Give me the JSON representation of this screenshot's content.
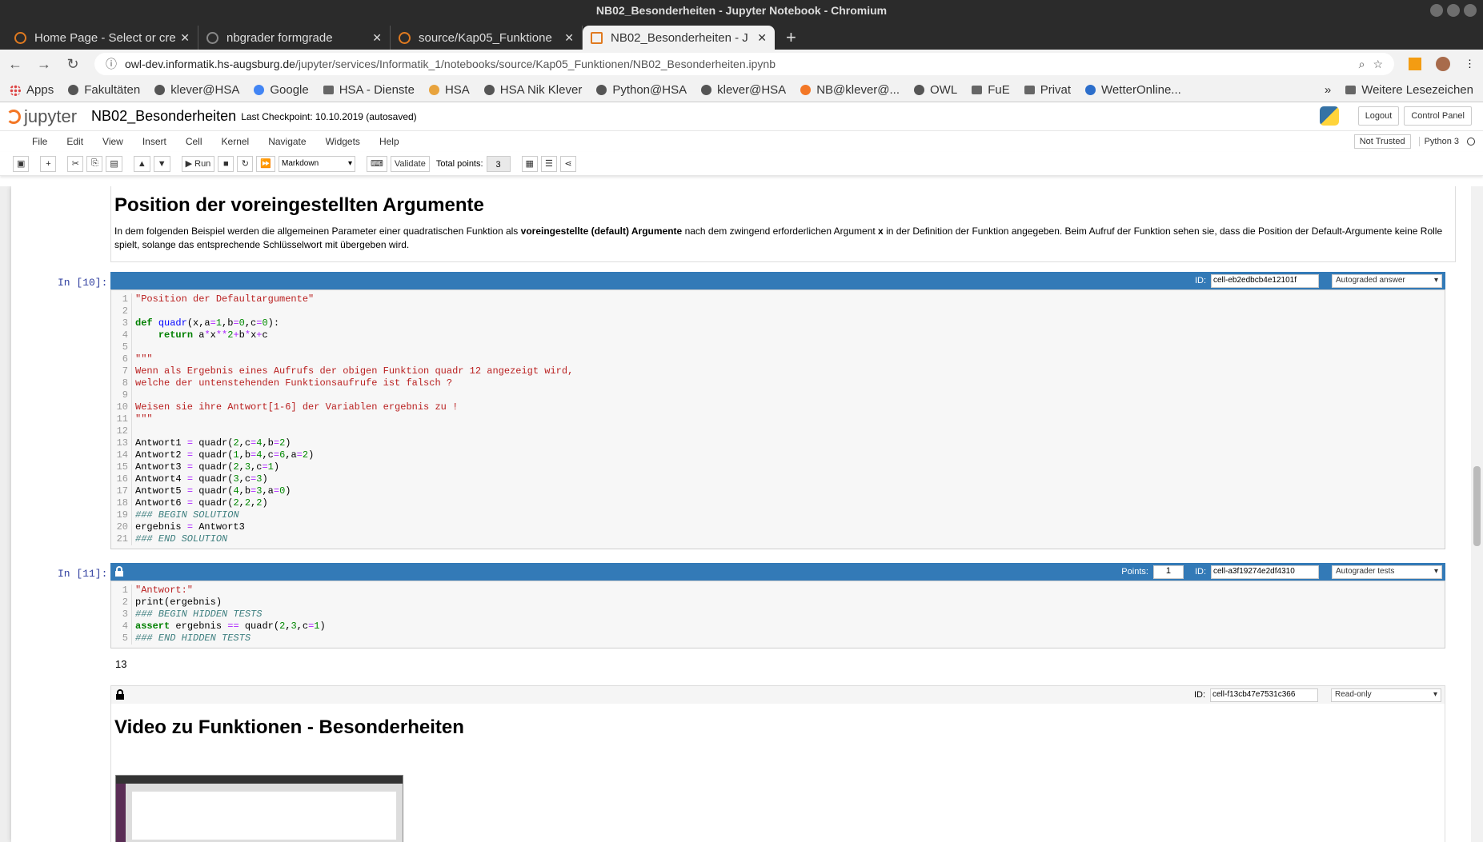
{
  "window": {
    "title": "NB02_Besonderheiten - Jupyter Notebook - Chromium"
  },
  "tabs": [
    {
      "label": "Home Page - Select or cre",
      "active": false
    },
    {
      "label": "nbgrader formgrade",
      "active": false
    },
    {
      "label": "source/Kap05_Funktione",
      "active": false
    },
    {
      "label": "NB02_Besonderheiten - J",
      "active": true
    }
  ],
  "address": {
    "host": "owl-dev.informatik.hs-augsburg.de",
    "path": "/jupyter/services/Informatik_1/notebooks/source/Kap05_Funktionen/NB02_Besonderheiten.ipynb"
  },
  "bookmarks": [
    "Apps",
    "Fakultäten",
    "klever@HSA",
    "Google",
    "HSA - Dienste",
    "HSA",
    "HSA Nik Klever",
    "Python@HSA",
    "klever@HSA",
    "NB@klever@...",
    "OWL",
    "FuE",
    "Privat",
    "WetterOnline..."
  ],
  "bookmarks_more": "»",
  "bookmarks_other": "Weitere Lesezeichen",
  "jupyter": {
    "logo_text": "jupyter",
    "notebook_name": "NB02_Besonderheiten",
    "checkpoint": "Last Checkpoint: 10.10.2019  (autosaved)",
    "logout": "Logout",
    "control_panel": "Control Panel"
  },
  "menu": [
    "File",
    "Edit",
    "View",
    "Insert",
    "Cell",
    "Kernel",
    "Navigate",
    "Widgets",
    "Help"
  ],
  "status": {
    "trusted": "Not Trusted",
    "kernel": "Python 3"
  },
  "toolbar": {
    "run": "Run",
    "cell_type": "Markdown",
    "validate": "Validate",
    "total_points_label": "Total points:",
    "total_points": "3"
  },
  "md1": {
    "heading": "Position der voreingestellten Argumente",
    "p_before": "In dem folgenden Beispiel werden die allgemeinen Parameter einer quadratischen Funktion als ",
    "p_bold1": "voreingestellte (default) Argumente",
    "p_mid": " nach dem zwingend erforderlichen Argument ",
    "p_bold2": "x",
    "p_after": " in der Definition der Funktion angegeben. Beim Aufruf der Funktion sehen sie, dass die Position der Default-Argumente keine Rolle spielt, solange das entsprechende Schlüsselwort mit übergeben wird."
  },
  "cell10": {
    "prompt": "In [10]:",
    "id_label": "ID:",
    "id": "cell-eb2edbcb4e12101f",
    "type": "Autograded answer",
    "lines": [
      "\"Position der Defaultargumente\"",
      "",
      "def quadr(x,a=1,b=0,c=0):",
      "    return a*x**2+b*x+c",
      "",
      "\"\"\"",
      "Wenn als Ergebnis eines Aufrufs der obigen Funktion quadr 12 angezeigt wird,",
      "welche der untenstehenden Funktionsaufrufe ist falsch ?",
      "",
      "Weisen sie ihre Antwort[1-6] der Variablen ergebnis zu !",
      "\"\"\"",
      "",
      "Antwort1 = quadr(2,c=4,b=2)",
      "Antwort2 = quadr(1,b=4,c=6,a=2)",
      "Antwort3 = quadr(2,3,c=1)",
      "Antwort4 = quadr(3,c=3)",
      "Antwort5 = quadr(4,b=3,a=0)",
      "Antwort6 = quadr(2,2,2)",
      "### BEGIN SOLUTION",
      "ergebnis = Antwort3",
      "### END SOLUTION"
    ]
  },
  "cell11": {
    "prompt": "In [11]:",
    "points_label": "Points:",
    "points": "1",
    "id_label": "ID:",
    "id": "cell-a3f19274e2df4310",
    "type": "Autograder tests",
    "lines": [
      "\"Antwort:\"",
      "print(ergebnis)",
      "### BEGIN HIDDEN TESTS",
      "assert ergebnis == quadr(2,3,c=1)",
      "### END HIDDEN TESTS"
    ],
    "output": "13"
  },
  "md2": {
    "id_label": "ID:",
    "id": "cell-f13cb47e7531c366",
    "type": "Read-only",
    "heading": "Video zu Funktionen - Besonderheiten"
  },
  "colors": {
    "cell_toolbar": "#337ab7",
    "accent": "#f37726"
  }
}
